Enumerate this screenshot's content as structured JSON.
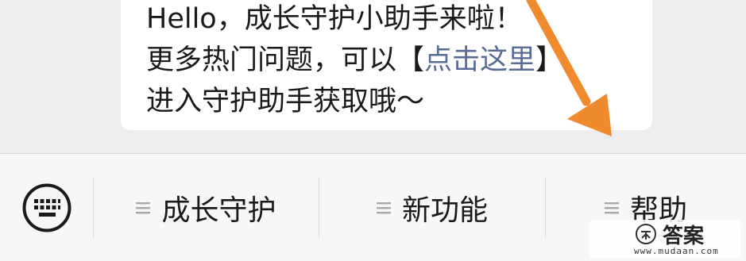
{
  "message": {
    "line1": "Hello，成长守护小助手来啦！",
    "line2_prefix": "更多热门问题，可以【",
    "line2_link": "点击这里",
    "line2_suffix": "】",
    "line3": "进入守护助手获取哦～"
  },
  "menu": {
    "keyboard_icon": "keyboard-icon",
    "items": [
      {
        "label": "成长守护",
        "icon": "hamburger-icon"
      },
      {
        "label": "新功能",
        "icon": "hamburger-icon"
      },
      {
        "label": "帮助",
        "icon": "hamburger-icon"
      }
    ]
  },
  "annotation": {
    "arrow_color": "#f08a2e"
  },
  "watermark": {
    "title": "答案",
    "url": "www.mudaan.com"
  },
  "colors": {
    "link": "#576b95",
    "bubble": "#ffffff",
    "background": "#ededed",
    "menu_bar": "#f7f7f7"
  }
}
